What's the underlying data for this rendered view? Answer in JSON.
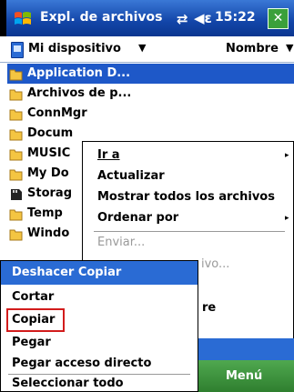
{
  "titlebar": {
    "title": "Expl. de archivos",
    "clock": "15:22",
    "close_label": "✕",
    "conn_glyph": "⇄",
    "vol_glyph": "◀ε"
  },
  "location": {
    "current": "Mi dispositivo",
    "sort": "Nombre",
    "caret": "▼"
  },
  "files": [
    "Application D...",
    "Archivos de p...",
    "ConnMgr",
    "Docum",
    "MUSIC",
    "My Do",
    "Storag",
    "Temp",
    "Windo"
  ],
  "context_menu": {
    "items": {
      "ir_a": "Ir a",
      "actualizar": "Actualizar",
      "mostrar": "Mostrar todos los archivos",
      "ordenar": "Ordenar por",
      "enviar": "Enviar...",
      "frag1": "ivo...",
      "frag2": "re"
    },
    "submenu_arrow": "▸"
  },
  "edit_menu": {
    "undo": "Deshacer Copiar",
    "cut": "Cortar",
    "copy": "Copiar",
    "paste": "Pegar",
    "paste_shortcut": "Pegar acceso directo",
    "select_all": "Seleccionar todo"
  },
  "softkey": {
    "menu_label": "Menú"
  },
  "colors": {
    "title_bar": "#1245a8",
    "selection": "#1e58c8",
    "softkey": "#3a903a",
    "highlight_box": "#d21c1c"
  }
}
